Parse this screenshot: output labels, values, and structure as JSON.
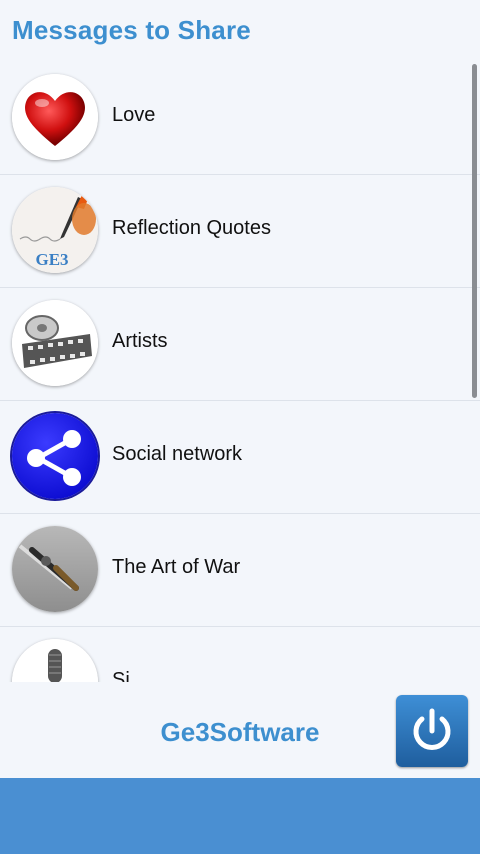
{
  "header": {
    "title": "Messages to Share"
  },
  "list": {
    "items": [
      {
        "label": "Love",
        "icon": "heart-icon"
      },
      {
        "label": "Reflection Quotes",
        "icon": "pen-writing-icon",
        "thumb_text": "GE3"
      },
      {
        "label": "Artists",
        "icon": "film-reel-icon"
      },
      {
        "label": "Social network",
        "icon": "share-icon"
      },
      {
        "label": "The Art of War",
        "icon": "sword-icon"
      },
      {
        "label": "Si",
        "icon": "microphone-icon"
      }
    ]
  },
  "footer": {
    "brand": "Ge3Software",
    "power_icon": "power-icon"
  },
  "colors": {
    "accent": "#3d8fcf",
    "bottom_bar": "#4a8fd2",
    "background": "#f3f6fb"
  }
}
